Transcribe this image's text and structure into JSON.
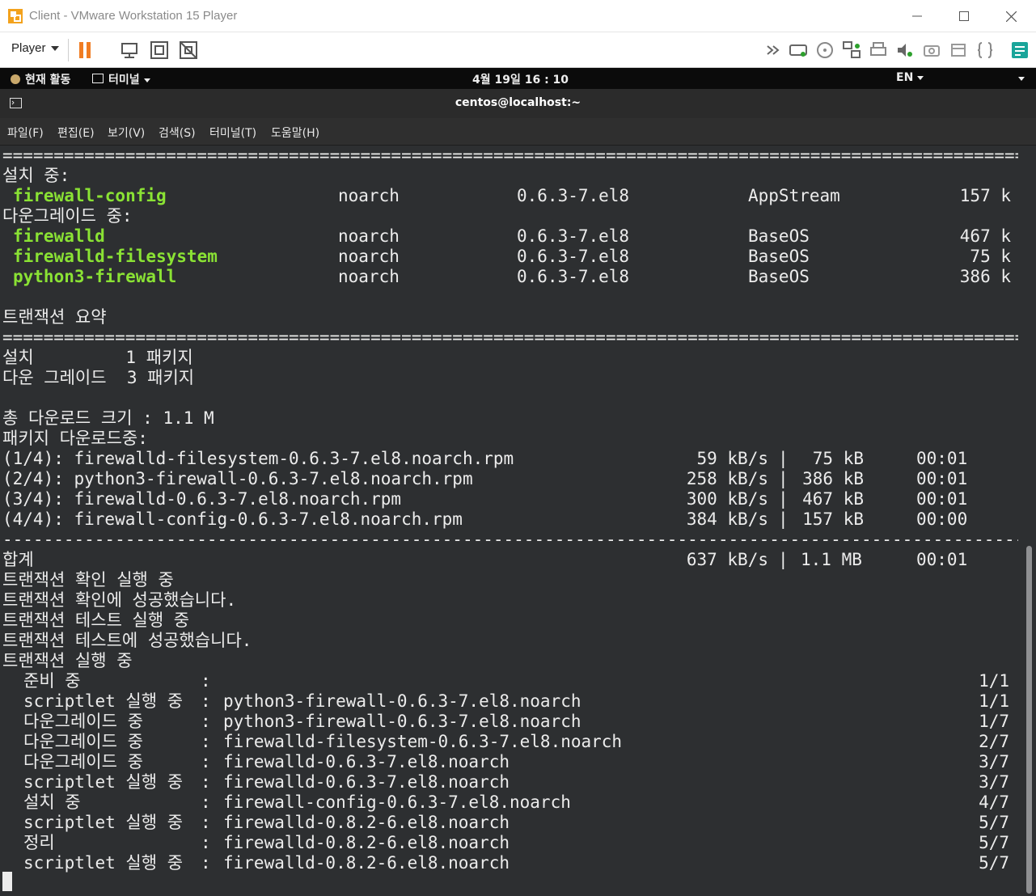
{
  "window": {
    "title": "Client - VMware Workstation 15 Player"
  },
  "vmware_toolbar": {
    "player_label": "Player",
    "left_icons": [
      "pause-icon",
      "send-ctrl-alt-del-icon",
      "fullscreen-icon",
      "unity-icon"
    ],
    "right_icons": [
      "more-devices-icon",
      "hard-disk-icon",
      "cd-dvd-icon",
      "network-icon",
      "printer-icon",
      "sound-icon",
      "camera-icon",
      "usb-icon",
      "more-icon",
      "vm-notes-icon"
    ]
  },
  "gnome": {
    "activities": "현재 활동",
    "app_menu": "터미널",
    "clock": "4월 19일  16 : 10",
    "lang": "EN"
  },
  "terminal": {
    "title": "centos@localhost:~",
    "menu": [
      "파일(F)",
      "편집(E)",
      "보기(V)",
      "검색(S)",
      "터미널(T)",
      "도움말(H)"
    ],
    "separator_eq": "================================================================================================================================",
    "separator_dash": "--------------------------------------------------------------------------------------------------------------------------------",
    "installing_header": "설치 중:",
    "downgrading_header": "다운그레이드 중:",
    "packages": [
      {
        "name": "firewall-config",
        "arch": "noarch",
        "version": "0.6.3-7.el8",
        "repo": "AppStream",
        "size": "157 k"
      },
      {
        "name": "firewalld",
        "arch": "noarch",
        "version": "0.6.3-7.el8",
        "repo": "BaseOS",
        "size": "467 k"
      },
      {
        "name": "firewalld-filesystem",
        "arch": "noarch",
        "version": "0.6.3-7.el8",
        "repo": "BaseOS",
        "size": "75 k"
      },
      {
        "name": "python3-firewall",
        "arch": "noarch",
        "version": "0.6.3-7.el8",
        "repo": "BaseOS",
        "size": "386 k"
      }
    ],
    "summary_header": "트랜잭션 요약",
    "summary_install": "설치         1 패키지",
    "summary_downgrade": "다운 그레이드  3 패키지",
    "total_download": "총 다운로드 크기 : 1.1 M",
    "downloading": "패키지 다운로드중:",
    "downloads": [
      {
        "file": "(1/4): firewalld-filesystem-0.6.3-7.el8.noarch.rpm",
        "rate": "59 kB/s",
        "size": "75 kB",
        "time": "00:01"
      },
      {
        "file": "(2/4): python3-firewall-0.6.3-7.el8.noarch.rpm",
        "rate": "258 kB/s",
        "size": "386 kB",
        "time": "00:01"
      },
      {
        "file": "(3/4): firewalld-0.6.3-7.el8.noarch.rpm",
        "rate": "300 kB/s",
        "size": "467 kB",
        "time": "00:01"
      },
      {
        "file": "(4/4): firewall-config-0.6.3-7.el8.noarch.rpm",
        "rate": "384 kB/s",
        "size": "157 kB",
        "time": "00:00"
      }
    ],
    "total": {
      "label": "합계",
      "rate": "637 kB/s",
      "size": "1.1 MB",
      "time": "00:01"
    },
    "status_lines": [
      "트랜잭션 확인 실행 중",
      "트랜잭션 확인에 성공했습니다.",
      "트랜잭션 테스트 실행 중",
      "트랜잭션 테스트에 성공했습니다.",
      "트랜잭션 실행 중"
    ],
    "steps": [
      {
        "action": "준비 중",
        "pkg": "",
        "count": "1/1"
      },
      {
        "action": "scriptlet 실행 중",
        "pkg": "python3-firewall-0.6.3-7.el8.noarch",
        "count": "1/1"
      },
      {
        "action": "다운그레이드 중",
        "pkg": "python3-firewall-0.6.3-7.el8.noarch",
        "count": "1/7"
      },
      {
        "action": "다운그레이드 중",
        "pkg": "firewalld-filesystem-0.6.3-7.el8.noarch",
        "count": "2/7"
      },
      {
        "action": "다운그레이드 중",
        "pkg": "firewalld-0.6.3-7.el8.noarch",
        "count": "3/7"
      },
      {
        "action": "scriptlet 실행 중",
        "pkg": "firewalld-0.6.3-7.el8.noarch",
        "count": "3/7"
      },
      {
        "action": "설치 중",
        "pkg": "firewall-config-0.6.3-7.el8.noarch",
        "count": "4/7"
      },
      {
        "action": "scriptlet 실행 중",
        "pkg": "firewalld-0.8.2-6.el8.noarch",
        "count": "5/7"
      },
      {
        "action": "정리",
        "pkg": "firewalld-0.8.2-6.el8.noarch",
        "count": "5/7"
      },
      {
        "action": "scriptlet 실행 중",
        "pkg": "firewalld-0.8.2-6.el8.noarch",
        "count": "5/7"
      }
    ]
  }
}
